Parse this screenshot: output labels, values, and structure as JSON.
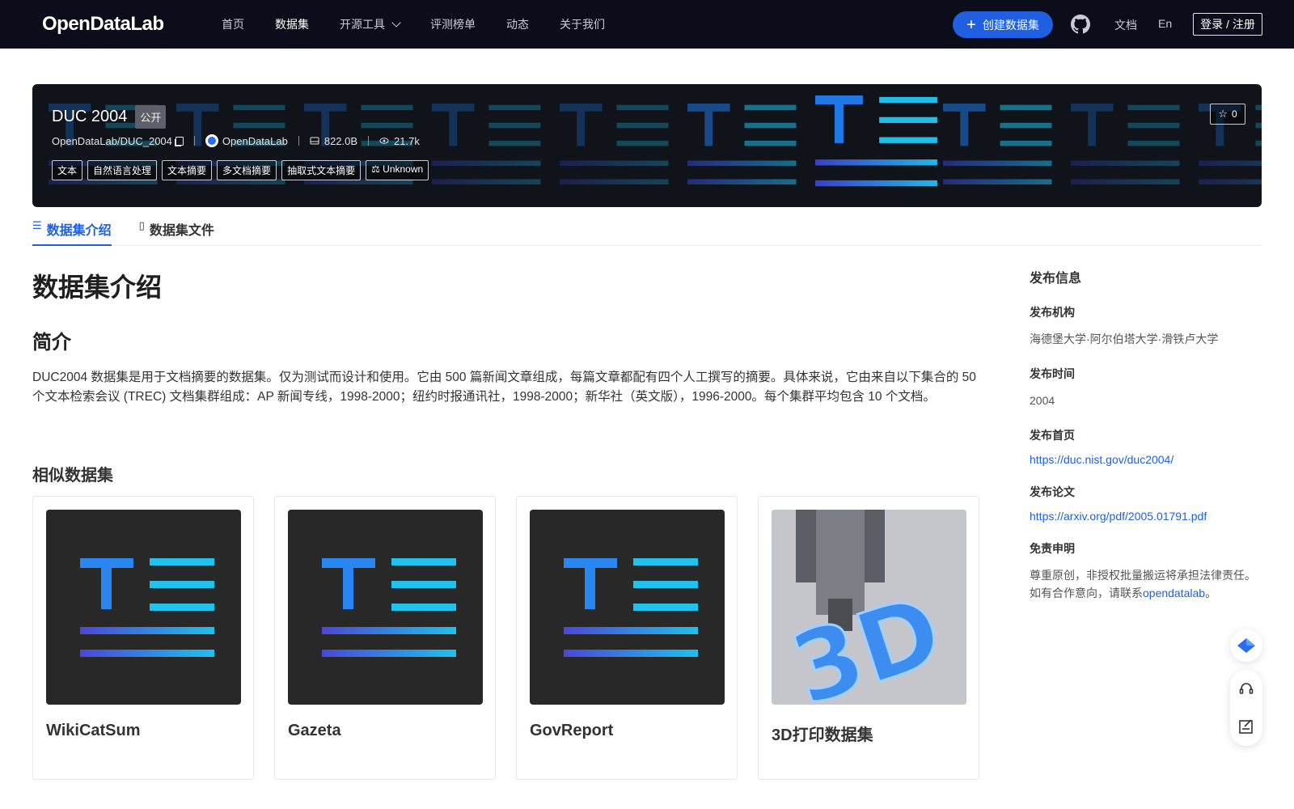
{
  "nav": {
    "logo_text": "OpenDataLab",
    "links": [
      "首页",
      "数据集",
      "开源工具",
      "评测榜单",
      "动态",
      "关于我们"
    ],
    "active_link": "数据集",
    "create_label": "创建数据集",
    "docs_label": "文档",
    "lang_label": "En",
    "login_label": "登录 / 注册"
  },
  "dataset": {
    "title": "DUC 2004",
    "visibility": "公开",
    "path": "OpenDataLab/DUC_2004",
    "org": "OpenDataLab",
    "size": "822.0B",
    "views": "21.7k",
    "tags": [
      "文本",
      "自然语言处理",
      "文本摘要",
      "多文档摘要",
      "抽取式文本摘要"
    ],
    "license": "Unknown",
    "stars": "0"
  },
  "tabs": {
    "intro": "数据集介绍",
    "files": "数据集文件"
  },
  "main": {
    "heading": "数据集介绍",
    "intro_heading": "简介",
    "description": "DUC2004 数据集是用于文档摘要的数据集。仅为测试而设计和使用。它由 500 篇新闻文章组成，每篇文章都配有四个人工撰写的摘要。具体来说，它由来自以下集合的 50 个文本检索会议 (TREC) 文档集群组成：AP 新闻专线，1998-2000；纽约时报通讯社，1998-2000；新华社（英文版），1996-2000。每个集群平均包含 10 个文档。",
    "similar_heading": "相似数据集",
    "similar": [
      {
        "name": "WikiCatSum",
        "thumb": "text-icon"
      },
      {
        "name": "Gazeta",
        "thumb": "text-icon"
      },
      {
        "name": "GovReport",
        "thumb": "text-icon"
      },
      {
        "name": "3D打印数据集",
        "thumb": "3d-print-photo"
      }
    ]
  },
  "sidebar": {
    "title": "发布信息",
    "org_label": "发布机构",
    "org_value": "海德堡大学·阿尔伯塔大学·滑铁卢大学",
    "time_label": "发布时间",
    "time_value": "2004",
    "home_label": "发布首页",
    "home_value": "https://duc.nist.gov/duc2004/",
    "paper_label": "发布论文",
    "paper_value": "https://arxiv.org/pdf/2005.01791.pdf",
    "disclaimer_label": "免责申明",
    "disclaimer_text": "尊重原创，非授权批量搬运将承担法律责任。如有合作意向，请联系",
    "disclaimer_link": "opendatalab",
    "disclaimer_end": "。"
  },
  "colors": {
    "nav_bg": "#0b0e1a",
    "accent": "#1f5fe0"
  }
}
